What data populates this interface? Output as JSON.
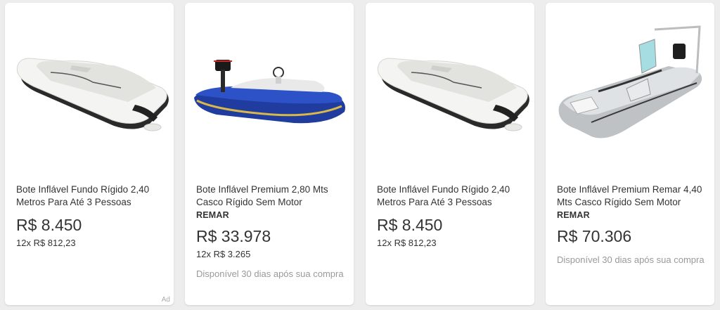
{
  "products": [
    {
      "title": "Bote Inflável Fundo Rígido 2,40 Metros Para Até 3 Pessoas",
      "brand": "",
      "price": "R$ 8.450",
      "installments": "12x R$ 812,23",
      "availability": "",
      "ad_label": "Ad",
      "image": "white-inflatable-boat-icon"
    },
    {
      "title": "Bote Inflável Premium 2,80 Mts Casco Rígido Sem Motor",
      "brand": "REMAR",
      "price": "R$ 33.978",
      "installments": "12x R$ 3.265",
      "availability": "Disponível 30 dias após sua compra",
      "ad_label": "",
      "image": "blue-rigid-boat-icon"
    },
    {
      "title": "Bote Inflável Fundo Rígido 2,40 Metros Para Até 3 Pessoas",
      "brand": "",
      "price": "R$ 8.450",
      "installments": "12x R$ 812,23",
      "availability": "",
      "ad_label": "",
      "image": "white-inflatable-boat-icon"
    },
    {
      "title": "Bote Inflável Premium Remar 4,40 Mts Casco Rígido Sem Motor",
      "brand": "REMAR",
      "price": "R$ 70.306",
      "installments": "",
      "availability": "Disponível 30 dias após sua compra",
      "ad_label": "",
      "image": "gray-rib-boat-icon"
    }
  ],
  "colors": {
    "background": "#ededed",
    "card": "#ffffff",
    "text": "#333333",
    "muted": "#999999"
  }
}
